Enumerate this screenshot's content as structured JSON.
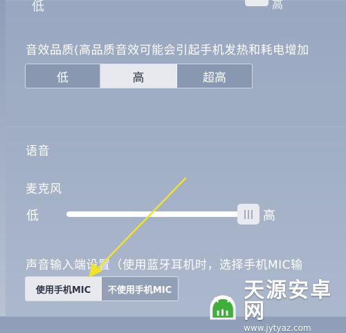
{
  "top_cut_off": {
    "label": "低",
    "tail": "高"
  },
  "sound_quality": {
    "label": "音效品质(高品质音效可能会引起手机发热和耗电增加",
    "options": [
      {
        "label": "低",
        "selected": false
      },
      {
        "label": "高",
        "selected": true
      },
      {
        "label": "超高",
        "selected": false
      }
    ]
  },
  "voice": {
    "title": "语音",
    "microphone": {
      "label": "麦克风",
      "min_label": "低",
      "max_label": "高",
      "level": 1.0
    },
    "input_setting": {
      "label": "声音输入端设置（使用蓝牙耳机时，选择手机MIC输",
      "options": [
        {
          "label": "使用手机MIC",
          "selected": true
        },
        {
          "label": "不使用手机MIC",
          "selected": false
        }
      ]
    }
  },
  "watermark": {
    "name": "天源安卓网",
    "url": "www.jytyaz.com"
  },
  "colors": {
    "annotation_arrow": "#f2e22a",
    "watermark_green": "#3fae3a"
  }
}
